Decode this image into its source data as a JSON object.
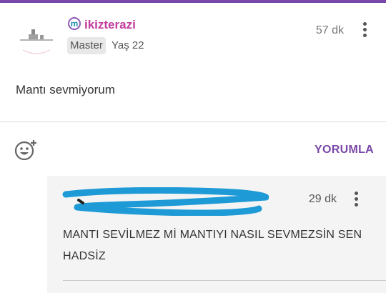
{
  "post": {
    "username": "ikizterazi",
    "brand_letter": "m",
    "rank": "Master",
    "age": "Yaş 22",
    "time": "57 dk",
    "body": "Mantı sevmiyorum"
  },
  "actions": {
    "comment_label": "YORUMLA"
  },
  "reply": {
    "time": "29 dk",
    "body": "MANTI SEVİLMEZ Mİ MANTIYI NASIL SEVMEZSİN SEN HADSİZ"
  },
  "colors": {
    "accent": "#7a48a8",
    "username": "#c23b9c",
    "brand_icon": "#1c8fb0",
    "redaction": "#1e9ad6"
  }
}
